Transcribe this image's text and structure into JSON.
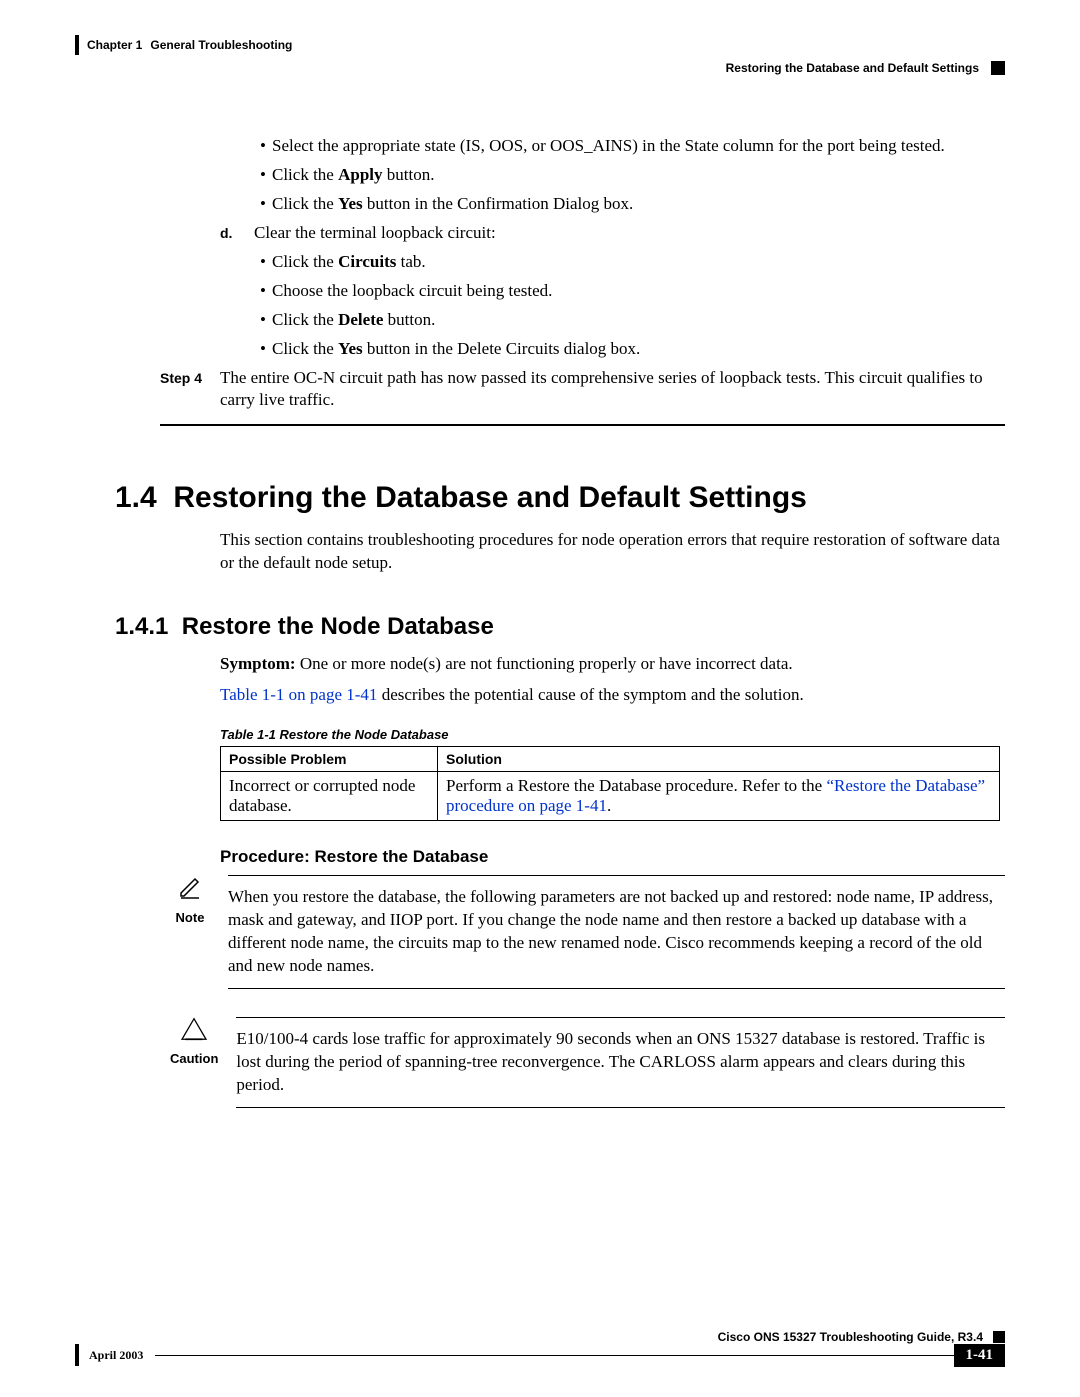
{
  "header": {
    "chapter": "Chapter 1",
    "title": "General Troubleshooting",
    "section_link": "Restoring the Database and Default Settings"
  },
  "intro_bullets": [
    "Select the appropriate state (IS, OOS, or OOS_AINS) in the State column for the port being tested.",
    "Click the Apply button.",
    "Click the Yes button in the Confirmation Dialog box."
  ],
  "sub_d": {
    "label": "d.",
    "text": "Clear the terminal loopback circuit:",
    "bullets": [
      "Click the Circuits tab.",
      "Choose the loopback circuit being tested.",
      "Click the Delete button.",
      "Click the Yes button in the Delete Circuits dialog box."
    ]
  },
  "step4": {
    "label": "Step 4",
    "text": "The entire OC-N circuit path has now passed its comprehensive series of loopback tests. This circuit qualifies to carry live traffic."
  },
  "section14": {
    "number": "1.4",
    "title": "Restoring the Database and Default Settings",
    "intro": "This section contains troubleshooting procedures for node operation errors that require restoration of software data or the default node setup."
  },
  "section141": {
    "number": "1.4.1",
    "title": "Restore the Node Database",
    "symptom_label": "Symptom:",
    "symptom_text": "One or more node(s) are not functioning properly or have incorrect data.",
    "ref_link": "Table 1-1 on page 1-41",
    "ref_text": " describes the potential cause of the symptom and the solution."
  },
  "table": {
    "caption": "Table 1-1    Restore the Node Database",
    "headers": [
      "Possible Problem",
      "Solution"
    ],
    "row": {
      "problem": "Incorrect or corrupted node database.",
      "solution_prefix": "Perform a Restore the Database procedure. Refer to the ",
      "solution_link": "“Restore the Database” procedure on page 1-41",
      "solution_suffix": "."
    }
  },
  "procedure": {
    "title": "Procedure: Restore the Database"
  },
  "note": {
    "label": "Note",
    "text": "When you restore the database, the following parameters are not backed up and restored: node name, IP address, mask and gateway, and IIOP port. If you change the node name and then restore a backed up database with a different node name, the circuits map to the new renamed node. Cisco recommends keeping a record of the old and new node names."
  },
  "caution": {
    "label": "Caution",
    "text": "E10/100-4 cards lose traffic for approximately 90 seconds when an ONS 15327 database is restored. Traffic is lost during the period of spanning-tree reconvergence. The CARLOSS alarm appears and clears during this period."
  },
  "footer": {
    "guide": "Cisco ONS 15327 Troubleshooting Guide, R3.4",
    "date": "April 2003",
    "page": "1-41"
  }
}
